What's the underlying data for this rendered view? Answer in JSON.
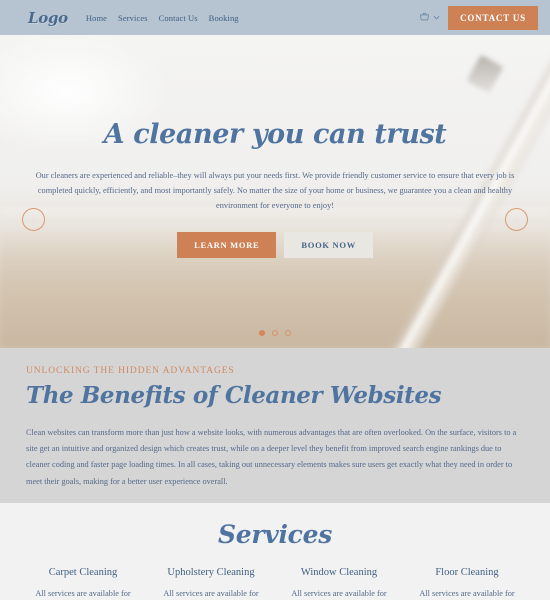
{
  "header": {
    "logo": "Logo",
    "nav": [
      {
        "label": "Home"
      },
      {
        "label": "Services"
      },
      {
        "label": "Contact Us"
      },
      {
        "label": "Booking"
      }
    ],
    "cart_icon": "shopping-cart-icon",
    "chevron_icon": "chevron-down-icon",
    "contact_button": "CONTACT US",
    "bg_color": "#b5c4d0",
    "accent_color": "#cf8156"
  },
  "hero": {
    "title": "A cleaner you can trust",
    "paragraph": "Our cleaners are experienced and reliable–they will always put your needs first. We provide friendly customer service to ensure that every job is completed quickly, efficiently, and most importantly safely. No matter the size of your home or business, we guarantee you a clean and healthy environment for everyone to enjoy!",
    "primary_button": "LEARN MORE",
    "secondary_button": "BOOK NOW",
    "prev_icon": "chevron-left-icon",
    "next_icon": "chevron-right-icon",
    "dots": [
      {
        "active": true
      },
      {
        "active": false
      },
      {
        "active": false
      }
    ],
    "title_color": "#4f74a0"
  },
  "benefits": {
    "eyebrow": "UNLOCKING THE HIDDEN ADVANTAGES",
    "title": "The Benefits of Cleaner Websites",
    "paragraph": "Clean websites can transform more than just how a website looks, with numerous advantages that are often overlooked. On the surface, visitors to a site get an intuitive and organized design which creates trust, while on a deeper level they benefit from improved search engine rankings due to cleaner coding and faster page loading times. In all cases, taking out unnecessary elements makes sure users get exactly what they need in order to meet their goals, making for a better user experience overall.",
    "bg_color": "#d5d5d5",
    "eyebrow_color": "#d08a62"
  },
  "services": {
    "title": "Services",
    "cards": [
      {
        "name": "Carpet Cleaning",
        "desc": "All services are available for"
      },
      {
        "name": "Upholstery Cleaning",
        "desc": "All services are available for"
      },
      {
        "name": "Window Cleaning",
        "desc": "All services are available for"
      },
      {
        "name": "Floor Cleaning",
        "desc": "All services are available for"
      }
    ]
  }
}
